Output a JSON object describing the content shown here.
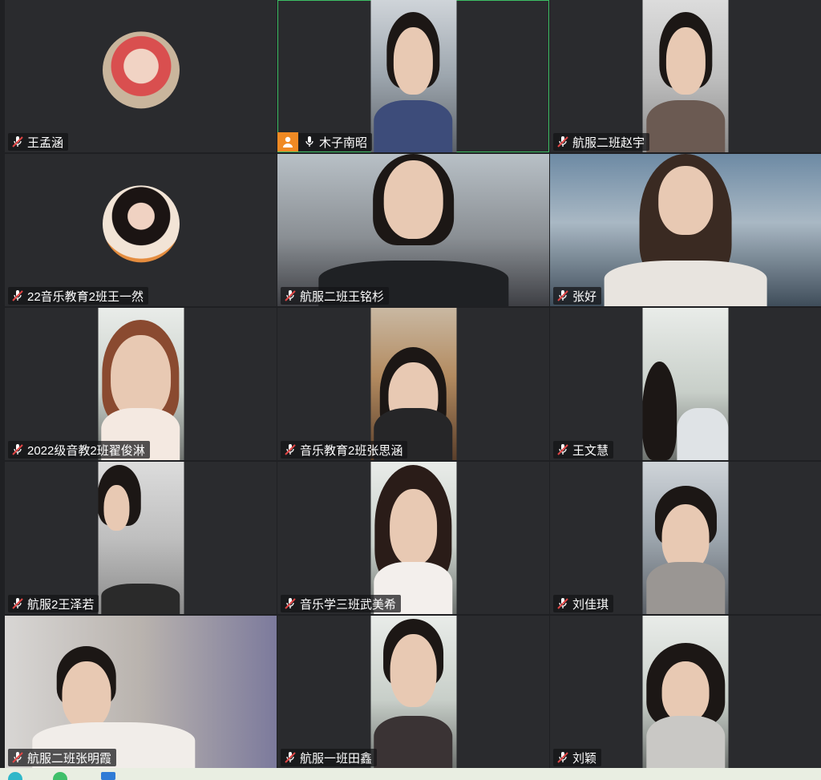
{
  "participants": [
    {
      "name": "王孟涵",
      "mic": "muted",
      "view": "avatar"
    },
    {
      "name": "木子南昭",
      "mic": "on",
      "view": "video",
      "host": true
    },
    {
      "name": "航服二班赵宇",
      "mic": "muted",
      "view": "video"
    },
    {
      "name": "22音乐教育2班王一然",
      "mic": "muted",
      "view": "avatar"
    },
    {
      "name": "航服二班王铭杉",
      "mic": "muted",
      "view": "video"
    },
    {
      "name": "张好",
      "mic": "muted",
      "view": "video"
    },
    {
      "name": "2022级音教2班翟俊淋",
      "mic": "muted",
      "view": "video"
    },
    {
      "name": "音乐教育2班张思涵",
      "mic": "muted",
      "view": "video"
    },
    {
      "name": "王文慧",
      "mic": "muted",
      "view": "video"
    },
    {
      "name": "航服2王泽若",
      "mic": "muted",
      "view": "video"
    },
    {
      "name": "音乐学三班武美希",
      "mic": "muted",
      "view": "video"
    },
    {
      "name": "刘佳琪",
      "mic": "muted",
      "view": "video"
    },
    {
      "name": "航服二班张明霞",
      "mic": "muted",
      "view": "video"
    },
    {
      "name": "航服一班田鑫",
      "mic": "muted",
      "view": "video"
    },
    {
      "name": "刘颖",
      "mic": "muted",
      "view": "video"
    }
  ],
  "colors": {
    "active_speaker_border": "#3dbf64",
    "host_badge": "#f08a24",
    "muted_mic": "#e04545",
    "tile_bg": "#2a2b2e"
  },
  "icons": {
    "muted": "mic-off-icon",
    "unmuted": "mic-icon",
    "host": "host-icon"
  }
}
